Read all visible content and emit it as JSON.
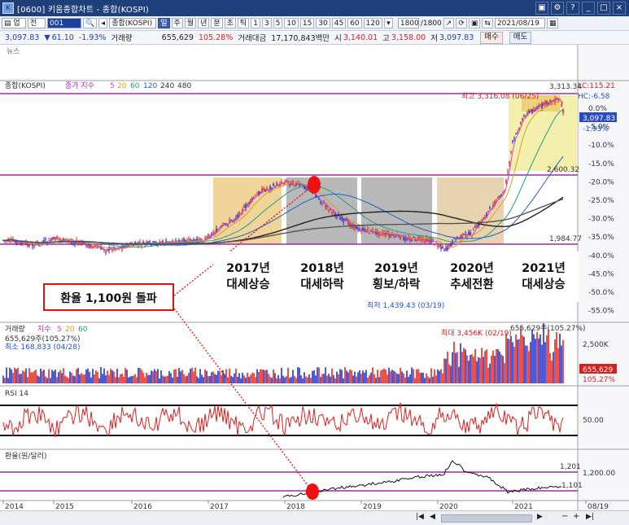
{
  "window": {
    "title": "[0600] 키움종합차트 - 종합(KOSPI)",
    "icon": "app-icon",
    "buttons": [
      "minimize-icon",
      "restore-icon",
      "close-icon",
      "help-icon",
      "pin-icon"
    ]
  },
  "toolbar": {
    "code": "001",
    "period_type": "전",
    "market": "종합(KOSPI)",
    "periods": [
      "일",
      "주",
      "월",
      "년",
      "분",
      "초",
      "틱"
    ],
    "active_period": "일",
    "intervals": [
      "1",
      "3",
      "5",
      "10",
      "15",
      "30",
      "45",
      "60",
      "120"
    ],
    "count": "1800",
    "count_total": "/1800",
    "date": "2021/08/19"
  },
  "info": {
    "price": "3,097.83",
    "change": "61.10",
    "change_pct": "-1.93%",
    "volume_label": "거래량",
    "volume": "655,629",
    "volume_pct": "105.28%",
    "amount_label": "거래대금",
    "amount": "17,170,843백만",
    "open_label": "시",
    "open": "3,140.01",
    "high_label": "고",
    "high": "3,158.00",
    "low_label": "저",
    "low": "3,097.83",
    "buy": "매수",
    "sell": "매도"
  },
  "panels": {
    "news": "뉴스",
    "main_label": "종합(KOSPI)",
    "ma_label": "종가 지수",
    "ma_periods": [
      "5",
      "20",
      "60",
      "120",
      "240",
      "480"
    ],
    "volume_label": "거래량",
    "volume_ma_label": "지수",
    "volume_ma": [
      "5",
      "20",
      "60"
    ],
    "rsi_label": "RSI 14",
    "fx_label": "환율(원/달러)"
  },
  "main_axis": {
    "ticks": [
      "0.0%",
      "-5.0%",
      "-10.0%",
      "-15.0%",
      "-20.0%",
      "-25.0%",
      "-30.0%",
      "-35.0%",
      "-40.0%",
      "-45.0%",
      "-50.0%",
      "-55.0%"
    ],
    "current": "3,097.83",
    "current_pct": "-1.93%",
    "lc": "LC:115.21",
    "hc": "HC:-6.58",
    "level_top": "3,313.34",
    "level_mid": "2,600.32",
    "level_low": "1,984.77"
  },
  "main_notes": {
    "high": "최고 3,316.08 (06/25)",
    "low": "최저 1,439.43 (03/19)"
  },
  "volume_axis": {
    "tick": "2,500K",
    "current": "655,629",
    "pct": "105.27%",
    "max": "최대 3,456K (02/19)",
    "current_note": "655,629주(105.27%)",
    "left_note": "655,629주(105.27%)",
    "min": "최소 168,833 (04/28)"
  },
  "rsi_axis": {
    "tick": "50.00"
  },
  "fx_axis": {
    "tick": "1,200.00",
    "upper": "1,201",
    "lower": "1,101"
  },
  "x_axis": [
    "2014",
    "2015",
    "2016",
    "2017",
    "2018",
    "2019",
    "2020",
    "2021",
    "08/19"
  ],
  "annotations": [
    {
      "line1": "2017년",
      "line2": "대세상승"
    },
    {
      "line1": "2018년",
      "line2": "대세하락"
    },
    {
      "line1": "2019년",
      "line2": "횡보/하락"
    },
    {
      "line1": "2020년",
      "line2": "추세전환"
    },
    {
      "line1": "2021년",
      "line2": "대세상승"
    }
  ],
  "callout": "환율 1,100원 돌파",
  "colors": {
    "candle_up": "#e8281e",
    "candle_down": "#2030d0",
    "purple_line": "#9a2fa0",
    "shade_orange": "#f0d49a",
    "shade_gray": "#b8b8b8",
    "shade_yellow": "#f5f2b0",
    "rsi_line": "#e02020",
    "marker": "#f01010"
  }
}
